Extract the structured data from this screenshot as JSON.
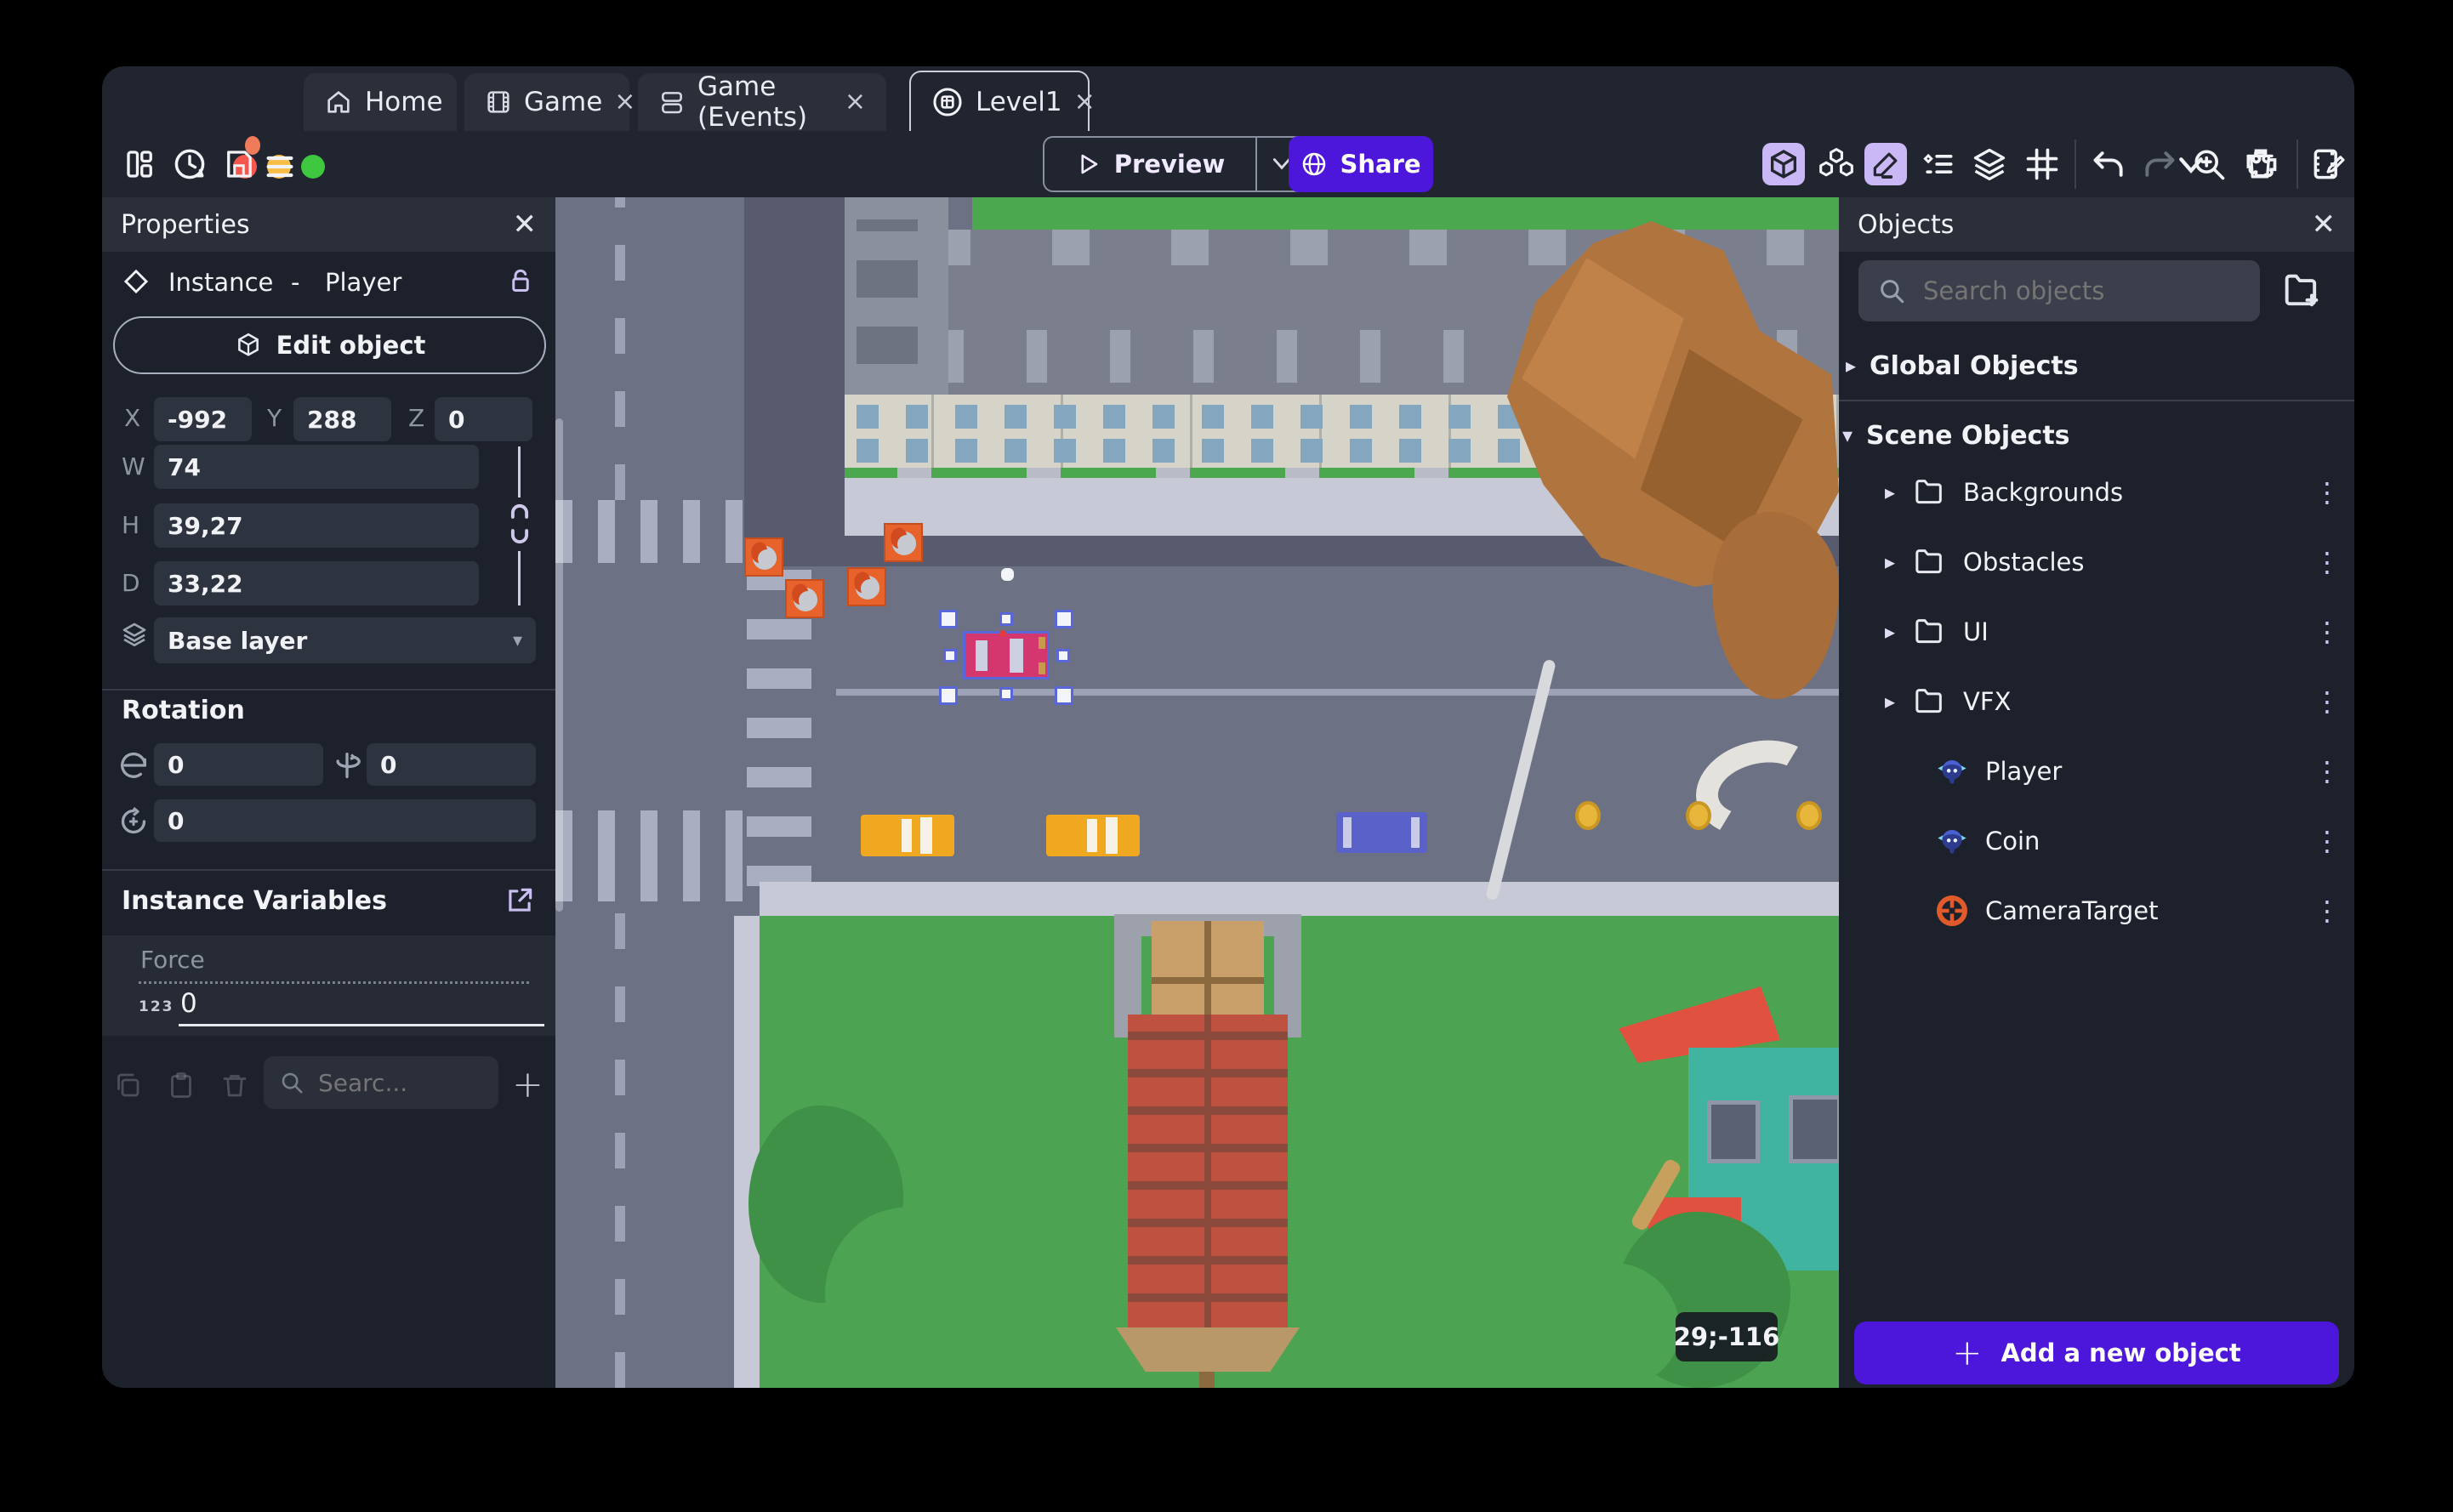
{
  "window": {
    "controls": [
      "close",
      "minimize",
      "maximize"
    ]
  },
  "tabs": [
    {
      "label": "Home",
      "icon": "home-icon"
    },
    {
      "label": "Game",
      "icon": "film-icon",
      "close": "×"
    },
    {
      "label": "Game (Events)",
      "icon": "events-icon",
      "close": "×"
    },
    {
      "label": "Level1",
      "icon": "scene-icon",
      "close": "×",
      "active": true
    }
  ],
  "toolbar": {
    "preview_label": "Preview",
    "share_label": "Share",
    "accent_purple": "#4C16DB",
    "active_icon_bg": "#C9B8F5"
  },
  "properties": {
    "title": "Properties",
    "instance_type": "Instance",
    "separator": "-",
    "instance_name": "Player",
    "edit_object_label": "Edit object",
    "x_label": "X",
    "y_label": "Y",
    "z_label": "Z",
    "x": "-992",
    "y": "288",
    "z": "0",
    "w_label": "W",
    "h_label": "H",
    "d_label": "D",
    "w": "74",
    "h": "39,27",
    "d": "33,22",
    "layer": "Base layer",
    "rotation_title": "Rotation",
    "rot_x": "0",
    "rot_y": "0",
    "rot_z": "0",
    "variables_title": "Instance Variables",
    "variable_name": "Force",
    "variable_type": "123",
    "variable_value": "0",
    "search_placeholder": "Searc..."
  },
  "objects": {
    "title": "Objects",
    "search_placeholder": "Search objects",
    "global_section": "Global Objects",
    "scene_section": "Scene Objects",
    "folders": [
      "Backgrounds",
      "Obstacles",
      "UI",
      "VFX"
    ],
    "items": [
      {
        "name": "Player",
        "icon": "monkey-icon"
      },
      {
        "name": "Coin",
        "icon": "monkey-icon"
      },
      {
        "name": "CameraTarget",
        "icon": "target-icon"
      }
    ],
    "add_button": "Add a new object"
  },
  "canvas": {
    "coordinate_badge": "29;-116",
    "selected_object": "Player",
    "colors": {
      "road": "#6C7184",
      "road_dark": "#575B6D",
      "crosswalk": "#A9AEC0",
      "sidewalk": "#C7CAD6",
      "grass": "#4CA351",
      "building": "#7B7F8D",
      "facade": "#D6D4C9",
      "taxi": "#F0A821",
      "blue_car": "#5A62C9",
      "player_car": "#D4376D",
      "rock": "#B0743F",
      "crate": "#E8622B",
      "coin": "#E8B63A",
      "tower_brick": "#BF5140",
      "house_roof": "#41B3A1",
      "house_wall": "#E0523F",
      "selection": "#5A67D8"
    }
  }
}
